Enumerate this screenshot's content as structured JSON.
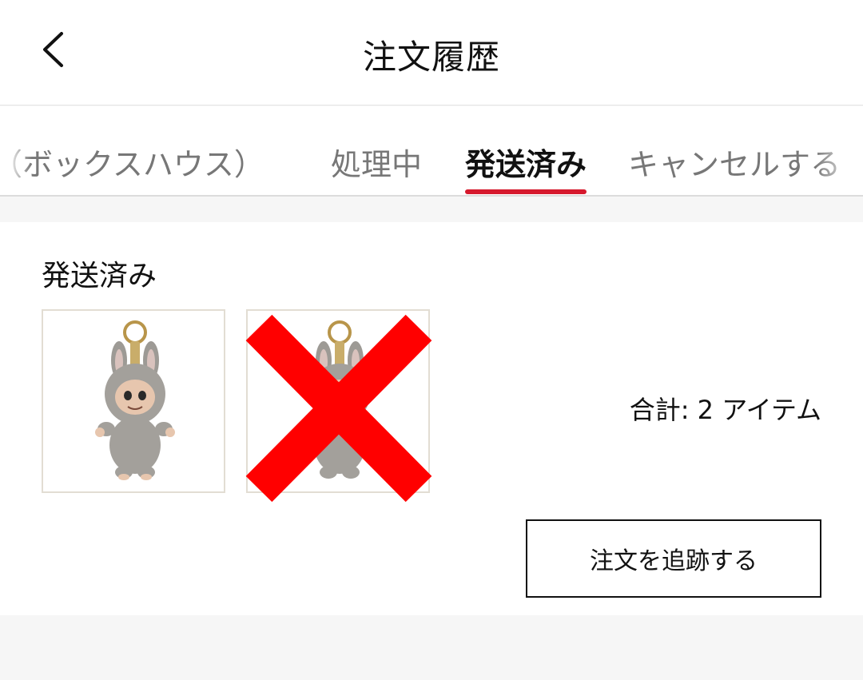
{
  "header": {
    "title": "注文履歴",
    "back_icon": "chevron-left-icon"
  },
  "tabs": [
    {
      "label": "（ボックスハウス）",
      "active": false
    },
    {
      "label": "処理中",
      "active": false
    },
    {
      "label": "発送済み",
      "active": true
    },
    {
      "label": "キャンセルする",
      "active": false
    }
  ],
  "order": {
    "status": "発送済み",
    "items": [
      {
        "name": "plush-keychain",
        "crossed_out": false
      },
      {
        "name": "plush-keychain",
        "crossed_out": true
      }
    ],
    "total_text": "合計: 2 アイテム",
    "track_button_label": "注文を追跡する"
  },
  "colors": {
    "accent": "#d6192d",
    "cross": "#ff0000",
    "background": "#f6f6f6"
  }
}
